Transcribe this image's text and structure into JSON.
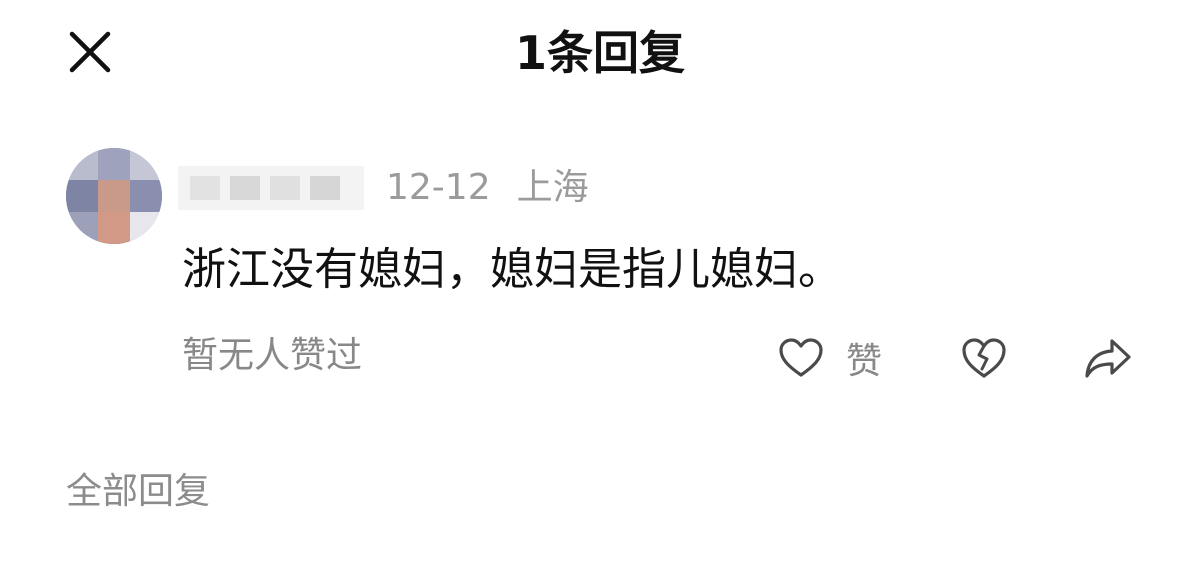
{
  "header": {
    "title": "1条回复",
    "close_icon": "close-icon"
  },
  "reply": {
    "date": "12-12",
    "location": "上海",
    "text": "浙江没有媳妇，媳妇是指儿媳妇。",
    "like_status": "暂无人赞过",
    "actions": {
      "like_label": "赞",
      "like_icon": "heart-outline-icon",
      "dislike_icon": "broken-heart-icon",
      "share_icon": "share-arrow-icon"
    }
  },
  "section": {
    "title": "全部回复"
  },
  "colors": {
    "text_primary": "#111111",
    "text_secondary": "#888888",
    "icon_gray": "#4a4a4a",
    "background": "#ffffff"
  }
}
